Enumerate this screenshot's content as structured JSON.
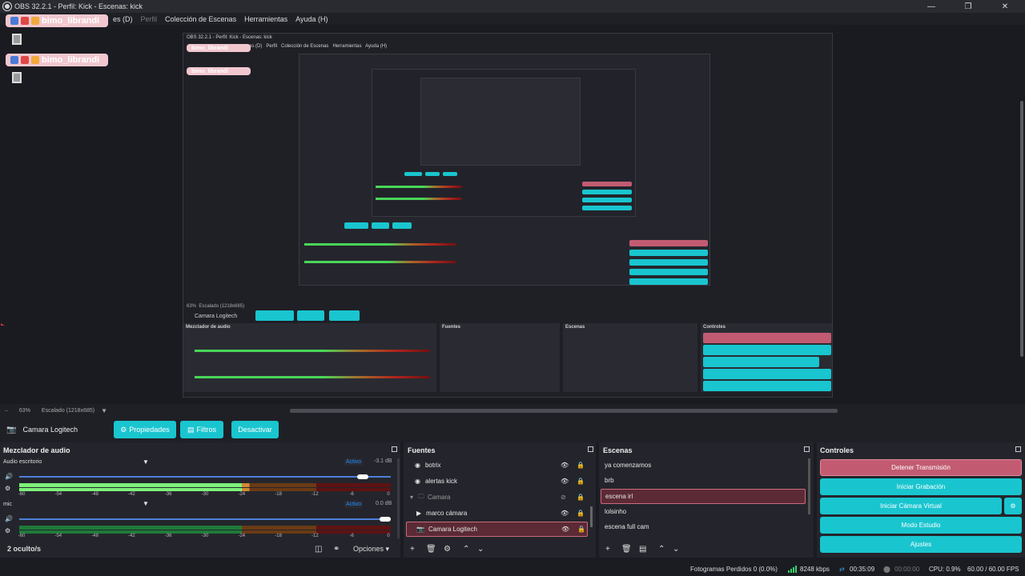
{
  "window": {
    "title": "OBS 32.2.1 - Perfil: Kick - Escenas: kick"
  },
  "menu": {
    "items": [
      "es (D)",
      "Perfil",
      "Colección de Escenas",
      "Herramientas",
      "Ayuda (H)"
    ]
  },
  "chat": {
    "username": "bimo_librandi"
  },
  "preview": {
    "nested_title": "OBS 32.2.1 - Perfil: Kick - Escenas: kick",
    "nested_menu": [
      "es (D)",
      "Perfil",
      "Colección de Escenas",
      "Herramientas",
      "Ayuda (H)"
    ],
    "nested_scale_label": "Escalado (1218x685)",
    "nested_zoom": "63%"
  },
  "zoom": {
    "percent": "63%",
    "scale_label": "Escalado (1218x685)"
  },
  "context": {
    "source_name": "Camara Logitech",
    "properties_label": "Propiedades",
    "filters_label": "Filtros",
    "deactivate_label": "Desactivar"
  },
  "mixer": {
    "title": "Mezclador de audio",
    "channels": [
      {
        "name": "Audio escritorio",
        "status": "Activo",
        "db": "-3.1 dB",
        "volume": 0.94,
        "level": 0.62
      },
      {
        "name": "mic",
        "status": "Activo",
        "db": "0.0 dB",
        "volume": 1.0,
        "level": 0.0
      }
    ],
    "scale": [
      "-60",
      "-54",
      "-48",
      "-42",
      "-36",
      "-30",
      "-24",
      "-18",
      "-12",
      "-6",
      "0"
    ],
    "hidden_label": "2 oculto/s",
    "options_label": "Opciones"
  },
  "sources": {
    "title": "Fuentes",
    "items": [
      {
        "name": "botrix",
        "icon": "browser-icon"
      },
      {
        "name": "alertas kick",
        "icon": "browser-icon"
      },
      {
        "name": "Camara",
        "icon": "folder-icon"
      },
      {
        "name": "marco cámara",
        "icon": "media-icon"
      },
      {
        "name": "Camara Logitech",
        "icon": "camera-icon"
      }
    ]
  },
  "scenes": {
    "title": "Escenas",
    "items": [
      "ya comenzamos",
      "brb",
      "escena irl",
      "lolsinho",
      "escena full cam"
    ],
    "selected": "escena irl"
  },
  "controls": {
    "title": "Controles",
    "stop_stream": "Detener Transmisión",
    "start_recording": "Iniciar Grabación",
    "start_virtual_cam": "Iniciar Cámara Virtual",
    "studio_mode": "Modo Estudio",
    "settings": "Ajustes"
  },
  "status": {
    "dropped_frames": "Fotogramas Perdidos 0 (0.0%)",
    "bitrate": "8248 kbps",
    "stream_time": "00:35:09",
    "record_time": "00:00:00",
    "cpu": "CPU: 0.9%",
    "fps": "60.00 / 60.00 FPS"
  },
  "colors": {
    "accent": "#19c5cf",
    "danger": "#c25b72",
    "selected": "#5b2a35",
    "green": "#38d36c"
  }
}
